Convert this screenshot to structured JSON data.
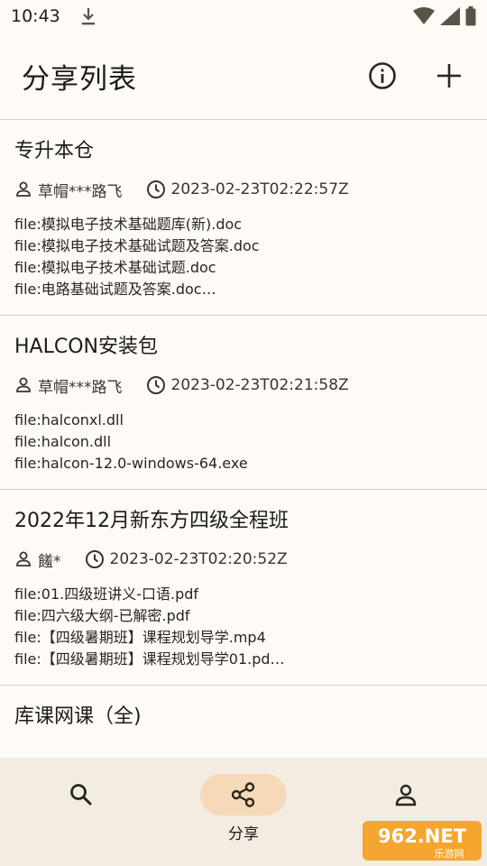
{
  "status": {
    "time": "10:43"
  },
  "header": {
    "title": "分享列表"
  },
  "shares": [
    {
      "title": "专升本仓",
      "user": "草帽***路飞",
      "time": "2023-02-23T02:22:57Z",
      "files": [
        "file:模拟电子技术基础题库(新).doc",
        "file:模拟电子技术基础试题及答案.doc",
        "file:模拟电子技术基础试题.doc",
        "file:电路基础试题及答案.doc…"
      ]
    },
    {
      "title": "HALCON安装包",
      "user": "草帽***路飞",
      "time": "2023-02-23T02:21:58Z",
      "files": [
        "file:halconxl.dll",
        "file:halcon.dll",
        "file:halcon-12.0-windows-64.exe"
      ]
    },
    {
      "title": "2022年12月新东方四级全程班",
      "user": "饈*",
      "time": "2023-02-23T02:20:52Z",
      "files": [
        "file:01.四级班讲义-口语.pdf",
        "file:四六级大纲-已解密.pdf",
        "file:【四级暑期班】课程规划导学.mp4",
        "file:【四级暑期班】课程规划导学01.pd…"
      ]
    },
    {
      "title": "库课网课（全)",
      "user": "",
      "time": "",
      "files": []
    }
  ],
  "nav": {
    "share_label": "分享"
  },
  "watermark": {
    "text": "962.NET",
    "sub": "乐游网"
  }
}
